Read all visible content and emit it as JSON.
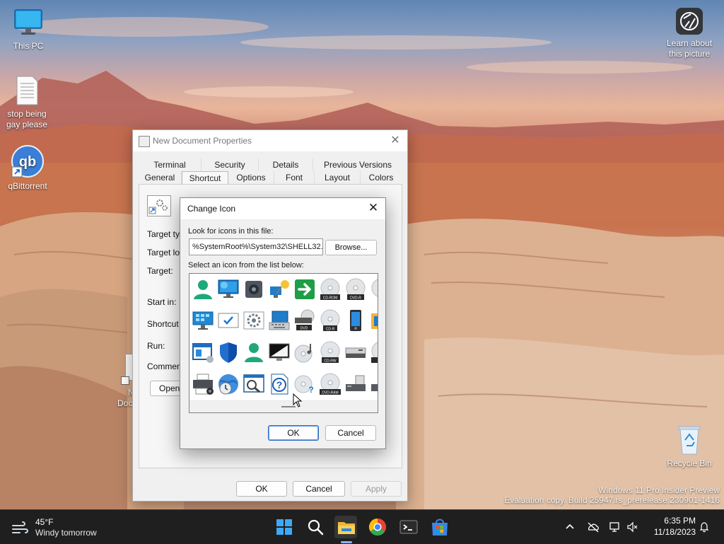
{
  "desktop": {
    "icons": [
      {
        "label": "This PC"
      },
      {
        "label_line1": "stop being",
        "label_line2": "gay please"
      },
      {
        "label": "qBittorrent"
      },
      {
        "label": "Recycle Bin"
      }
    ],
    "spotlight": {
      "line1": "Learn about",
      "line2": "this picture"
    },
    "watermark": {
      "line1": "Windows 11 Pro Insider Preview",
      "line2": "Evaluation copy. Build 25947.rs_prerelease.230901-1416"
    },
    "partial_icon_label_1": "N",
    "partial_icon_label_2": "Doc"
  },
  "properties_window": {
    "title": "New  Document Properties",
    "tabs_row1": [
      "Terminal",
      "Security",
      "Details",
      "Previous Versions"
    ],
    "tabs_row2": [
      "General",
      "Shortcut",
      "Options",
      "Font",
      "Layout",
      "Colors"
    ],
    "active_tab": "Shortcut",
    "fields": {
      "target_type": "Target typ",
      "target_location": "Target loc",
      "target": "Target:",
      "start_in": "Start in:",
      "shortcut_key": "Shortcut k",
      "run": "Run:",
      "comment": "Comment:"
    },
    "open_button": "Open",
    "buttons": {
      "ok": "OK",
      "cancel": "Cancel",
      "apply": "Apply"
    }
  },
  "change_icon": {
    "title": "Change Icon",
    "look_label": "Look for icons in this file:",
    "file_path": "%SystemRoot%\\System32\\SHELL32.dll",
    "browse": "Browse...",
    "list_label": "Select an icon from the list below:",
    "icons": [
      [
        "user-icon",
        "monitor-icon",
        "speaker-icon",
        "network-icon",
        "arrow-icon",
        "cdrom-icon",
        "dvdr-icon",
        "disc-partial-icon"
      ],
      [
        "control-panel-icon",
        "checkbox-window-icon",
        "gear-icon",
        "keyboard-icon",
        "dvd-drive-icon",
        "cdr-icon",
        "phone-icon",
        "folder-partial-icon"
      ],
      [
        "window-icon",
        "shield-icon",
        "user-alt-icon",
        "screen-icon",
        "music-disc-icon",
        "cdrw-icon",
        "drive-icon",
        "dv-partial-icon"
      ],
      [
        "printer-icon",
        "globe-clock-icon",
        "search-window-icon",
        "help-icon",
        "disc-question-icon",
        "dvdram-icon",
        "drive-dark-icon",
        "drive-partial-icon"
      ]
    ],
    "disc_labels": {
      "cdrom": "CD-ROM",
      "dvdr": "DVD-R",
      "dvd": "DVD",
      "cdr": "CD-R",
      "cdrw": "CD-RW",
      "dvdram": "DVD-RAM"
    },
    "ok": "OK",
    "cancel": "Cancel"
  },
  "taskbar": {
    "weather_temp": "45°F",
    "weather_desc": "Windy tomorrow",
    "apps": [
      "start-icon",
      "search-icon",
      "file-explorer-icon",
      "chrome-icon",
      "terminal-icon",
      "store-icon"
    ],
    "time": "6:35 PM",
    "date": "11/18/2023"
  }
}
